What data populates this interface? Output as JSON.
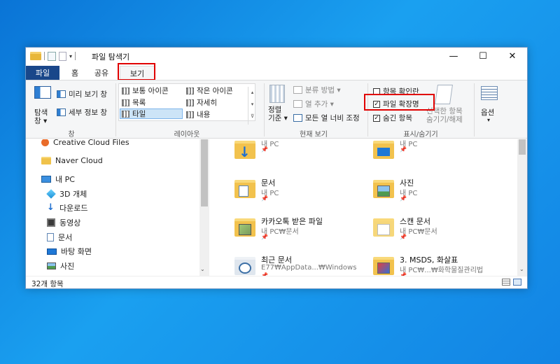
{
  "window": {
    "title": "파일 탐색기",
    "minimize": "—",
    "maximize": "☐",
    "close": "✕"
  },
  "tabs": {
    "file": "파일",
    "home": "홈",
    "share": "공유",
    "view": "보기"
  },
  "ribbon": {
    "panes": {
      "nav_pane": "탐색\n창 ▾",
      "preview_pane": "미리 보기 창",
      "details_pane": "세부 정보 창",
      "group_label": "창"
    },
    "layout": {
      "items": [
        "보통 아이콘",
        "작은 아이콘",
        "목록",
        "자세히",
        "타일",
        "내용"
      ],
      "selected": "타일",
      "group_label": "레이아웃"
    },
    "current_view": {
      "sort_by": "정렬\n기준 ▾",
      "group_by": "분류 방법 ▾",
      "add_columns": "열 추가 ▾",
      "size_all_columns": "모든 열 너비 조정",
      "group_label": "현재 보기"
    },
    "show_hide": {
      "item_check_boxes": "항목 확인란",
      "item_check_boxes_checked": false,
      "file_name_extensions": "파일 확장명",
      "file_name_extensions_checked": true,
      "hidden_items": "숨긴 항목",
      "hidden_items_checked": true,
      "hide_selected": "선택한 항목\n숨기기/해제",
      "group_label": "표시/숨기기"
    },
    "options": {
      "label": "옵션",
      "arrow": "▾"
    }
  },
  "nav": {
    "items": [
      {
        "label": "Creative Cloud Files",
        "icon": "creative-cloud-icon"
      },
      {
        "label": "Naver Cloud",
        "icon": "folder-icon"
      },
      {
        "label": "내 PC",
        "icon": "pc-icon"
      },
      {
        "label": "3D 개체",
        "icon": "3d-objects-icon"
      },
      {
        "label": "다운로드",
        "icon": "download-icon"
      },
      {
        "label": "동영상",
        "icon": "video-icon"
      },
      {
        "label": "문서",
        "icon": "document-icon"
      },
      {
        "label": "바탕 화면",
        "icon": "desktop-icon"
      },
      {
        "label": "사진",
        "icon": "pictures-icon"
      }
    ]
  },
  "main": {
    "tiles": [
      {
        "name": "",
        "location": "내 PC",
        "icon": "download-folder-icon"
      },
      {
        "name": "",
        "location": "내 PC",
        "icon": "desktop-folder-icon"
      },
      {
        "name": "문서",
        "location": "내 PC",
        "icon": "documents-folder-icon"
      },
      {
        "name": "사진",
        "location": "내 PC",
        "icon": "pictures-folder-icon"
      },
      {
        "name": "카카오톡 받은 파일",
        "location": "내 PC₩문서",
        "icon": "kakaotalk-folder-icon"
      },
      {
        "name": "스캔 문서",
        "location": "내 PC₩문서",
        "icon": "scan-folder-icon"
      },
      {
        "name": "최근 문서",
        "location": "E77₩AppData...₩Windows",
        "icon": "recent-docs-folder-icon"
      },
      {
        "name": "3. MSDS, 화살표",
        "location": "내 PC₩...₩화학물질관리법",
        "icon": "msds-folder-icon"
      }
    ],
    "pin": "📌"
  },
  "status": {
    "item_count": "32개 항목"
  },
  "colors": {
    "file_tab": "#19478a",
    "highlight": "#e00000",
    "folder": "#f2c24d",
    "desktop": "#1284e4"
  }
}
